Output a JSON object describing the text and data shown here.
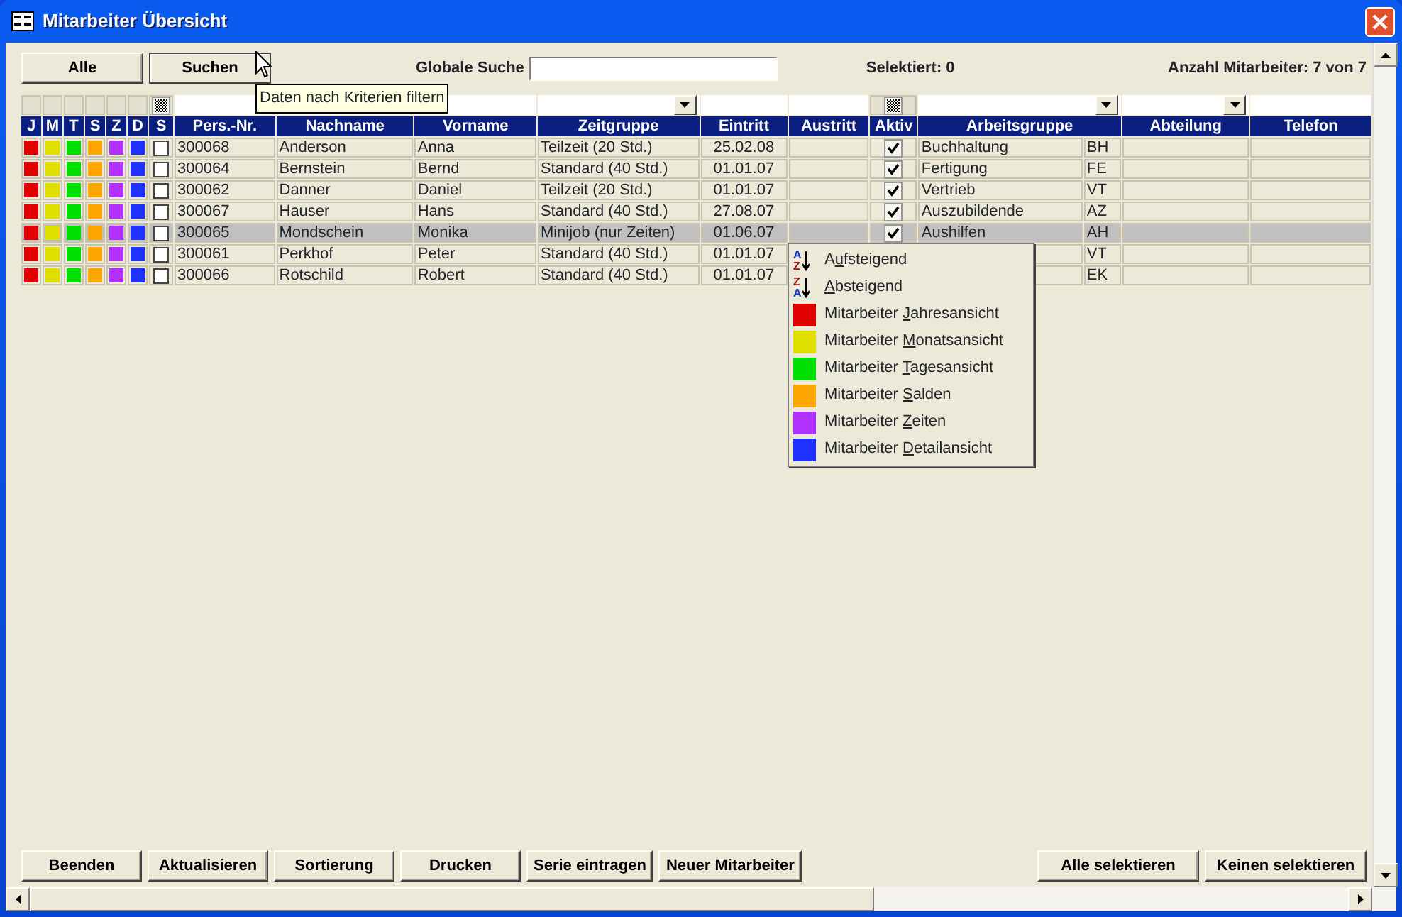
{
  "window": {
    "title": "Mitarbeiter Übersicht"
  },
  "toolbar": {
    "buttons": [
      {
        "label": "Alle",
        "hover": false
      },
      {
        "label": "Suchen",
        "hover": true
      }
    ],
    "search_label": "Globale Suche",
    "selected_count": "Selektiert: 0",
    "employee_count": "Anzahl Mitarbeiter: 7 von 7"
  },
  "tooltip": "Daten nach Kriterien filtern",
  "table": {
    "color_columns": [
      {
        "label": "J",
        "color": "#e00000"
      },
      {
        "label": "M",
        "color": "#e0e000"
      },
      {
        "label": "T",
        "color": "#00e000"
      },
      {
        "label": "S",
        "color": "#ffa500"
      },
      {
        "label": "Z",
        "color": "#b030ff"
      },
      {
        "label": "D",
        "color": "#2030ff"
      }
    ],
    "columns": [
      "S",
      "Pers.-Nr.",
      "Nachname",
      "Vorname",
      "Zeitgruppe",
      "Eintritt",
      "Austritt",
      "Aktiv",
      "Arbeitsgruppe",
      "Abteilung",
      "Telefon"
    ],
    "rows": [
      {
        "marked": false,
        "selected": false,
        "pers_nr": "300068",
        "nachname": "Anderson",
        "vorname": "Anna",
        "zeitgruppe": "Teilzeit (20 Std.)",
        "eintritt": "25.02.08",
        "aktiv": true,
        "arbeitsgruppe": "Buchhaltung",
        "code": "BH"
      },
      {
        "marked": false,
        "selected": false,
        "pers_nr": "300064",
        "nachname": "Bernstein",
        "vorname": "Bernd",
        "zeitgruppe": "Standard (40 Std.)",
        "eintritt": "01.01.07",
        "aktiv": true,
        "arbeitsgruppe": "Fertigung",
        "code": "FE"
      },
      {
        "marked": false,
        "selected": false,
        "pers_nr": "300062",
        "nachname": "Danner",
        "vorname": "Daniel",
        "zeitgruppe": "Teilzeit (20 Std.)",
        "eintritt": "01.01.07",
        "aktiv": true,
        "arbeitsgruppe": "Vertrieb",
        "code": "VT"
      },
      {
        "marked": false,
        "selected": false,
        "pers_nr": "300067",
        "nachname": "Hauser",
        "vorname": "Hans",
        "zeitgruppe": "Standard (40 Std.)",
        "eintritt": "27.08.07",
        "aktiv": true,
        "arbeitsgruppe": "Auszubildende",
        "code": "AZ"
      },
      {
        "marked": false,
        "selected": true,
        "pers_nr": "300065",
        "nachname": "Mondschein",
        "vorname": "Monika",
        "zeitgruppe": "Minijob (nur Zeiten)",
        "eintritt": "01.06.07",
        "aktiv": true,
        "arbeitsgruppe": "Aushilfen",
        "code": "AH"
      },
      {
        "marked": false,
        "selected": false,
        "pers_nr": "300061",
        "nachname": "Perkhof",
        "vorname": "Peter",
        "zeitgruppe": "Standard (40 Std.)",
        "eintritt": "01.01.07",
        "code": "VT"
      },
      {
        "marked": false,
        "selected": false,
        "pers_nr": "300066",
        "nachname": "Rotschild",
        "vorname": "Robert",
        "zeitgruppe": "Standard (40 Std.)",
        "eintritt": "01.01.07",
        "code": "EK"
      }
    ]
  },
  "context_menu": [
    {
      "kind": "sort_asc",
      "icon_top": "A",
      "icon_bottom": "Z",
      "prefix": "A",
      "key": "u",
      "rest": "fsteigend"
    },
    {
      "kind": "sort_desc",
      "icon_top": "Z",
      "icon_bottom": "A",
      "key": "A",
      "rest": "bsteigend"
    },
    {
      "kind": "view",
      "color": "#e00000",
      "prefix": "Mitarbeiter ",
      "key": "J",
      "rest": "ahresansicht"
    },
    {
      "kind": "view",
      "color": "#e0e000",
      "prefix": "Mitarbeiter ",
      "key": "M",
      "rest": "onatsansicht"
    },
    {
      "kind": "view",
      "color": "#00e000",
      "prefix": "Mitarbeiter ",
      "key": "T",
      "rest": "agesansicht"
    },
    {
      "kind": "view",
      "color": "#ffa500",
      "prefix": "Mitarbeiter ",
      "key": "S",
      "rest": "alden"
    },
    {
      "kind": "view",
      "color": "#b030ff",
      "prefix": "Mitarbeiter ",
      "key": "Z",
      "rest": "eiten"
    },
    {
      "kind": "view",
      "color": "#2030ff",
      "prefix": "Mitarbeiter ",
      "key": "D",
      "rest": "etailansicht"
    }
  ],
  "footer": {
    "left_buttons": [
      "Beenden",
      "Aktualisieren",
      "Sortierung",
      "Drucken",
      "Serie eintragen",
      "Neuer Mitarbeiter"
    ],
    "right_buttons": [
      "Alle selektieren",
      "Keinen selektieren"
    ]
  }
}
